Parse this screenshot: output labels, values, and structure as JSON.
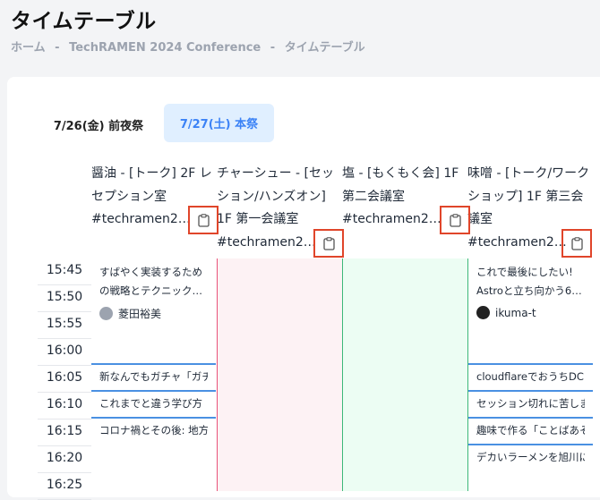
{
  "page_title": "タイムテーブル",
  "breadcrumb": [
    "ホーム",
    "-",
    "TechRAMEN 2024 Conference",
    "-",
    "タイムテーブル"
  ],
  "tabs": [
    {
      "label": "7/26(金) 前夜祭",
      "active": false
    },
    {
      "label": "7/27(土) 本祭",
      "active": true
    }
  ],
  "tracks": [
    {
      "name": "醤油 - [トーク] 2F レセプション室",
      "tag": "#techramen24..."
    },
    {
      "name": "チャーシュー - [セッション/ハンズオン] 1F 第一会議室",
      "tag": "#techramen24..."
    },
    {
      "name": "塩 - [もくもく会] 1F 第二会議室",
      "tag": "#techramen24..."
    },
    {
      "name": "味噌 - [トーク/ワークショップ] 1F 第三会議室",
      "tag": "#techramen24..."
    }
  ],
  "times": [
    "15:45",
    "15:50",
    "15:55",
    "16:00",
    "16:05",
    "16:10",
    "16:15",
    "16:20",
    "16:25"
  ],
  "sessions": {
    "shoyu": [
      {
        "title": "すばやく実装するための戦略とテクニック…",
        "speaker": "菱田裕美"
      },
      {
        "title": "新なんでもガチャ「ガチ"
      },
      {
        "title": "これまでと違う学び方"
      },
      {
        "title": "コロナ禍とその後: 地方"
      }
    ],
    "miso": [
      {
        "title": "これで最後にしたい! Astroと立ち向かう6…",
        "speaker": "ikuma-t"
      },
      {
        "title": "cloudflareでおうちDC"
      },
      {
        "title": "セッション切れに苦しま"
      },
      {
        "title": "趣味で作る「ことばあそ"
      },
      {
        "title": "デカいラーメンを旭川に"
      }
    ]
  },
  "colors": {
    "accent": "#3b82f6",
    "highlight_box": "#e0452a",
    "chashu_bg": "#fdf2f4",
    "shio_bg": "#ecfdf3"
  }
}
